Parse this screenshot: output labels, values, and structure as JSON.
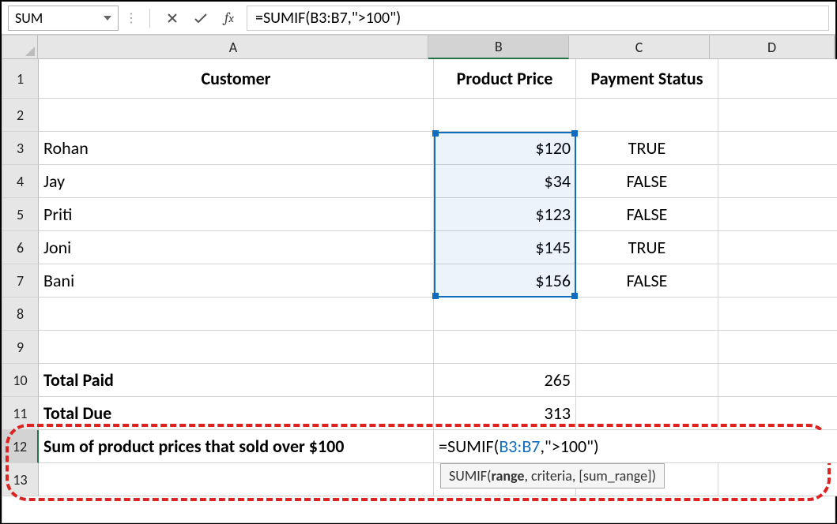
{
  "toolbar": {
    "namebox": "SUM",
    "formula": "=SUMIF(B3:B7,\">100\")"
  },
  "columns": [
    "A",
    "B",
    "C",
    "D"
  ],
  "rows": [
    "1",
    "2",
    "3",
    "4",
    "5",
    "6",
    "7",
    "8",
    "9",
    "10",
    "11",
    "12",
    "13"
  ],
  "header": {
    "a": "Customer",
    "b": "Product Price",
    "c": "Payment Status"
  },
  "data": [
    {
      "name": "Rohan",
      "price": "$120",
      "status": "TRUE"
    },
    {
      "name": "Jay",
      "price": "$34",
      "status": "FALSE"
    },
    {
      "name": "Priti",
      "price": "$123",
      "status": "FALSE"
    },
    {
      "name": "Joni",
      "price": "$145",
      "status": "TRUE"
    },
    {
      "name": "Bani",
      "price": "$156",
      "status": "FALSE"
    }
  ],
  "totals": {
    "paid_label": "Total Paid",
    "paid_value": "265",
    "due_label": "Total Due",
    "due_value": "313"
  },
  "row12": {
    "label": "Sum of product prices that sold over $100",
    "formula_prefix": "=SUMIF(",
    "formula_range": "B3:B7",
    "formula_suffix": ",\">100\")"
  },
  "tooltip": {
    "fn": "SUMIF",
    "arg1": "range",
    "rest": ", criteria, [sum_range])"
  }
}
